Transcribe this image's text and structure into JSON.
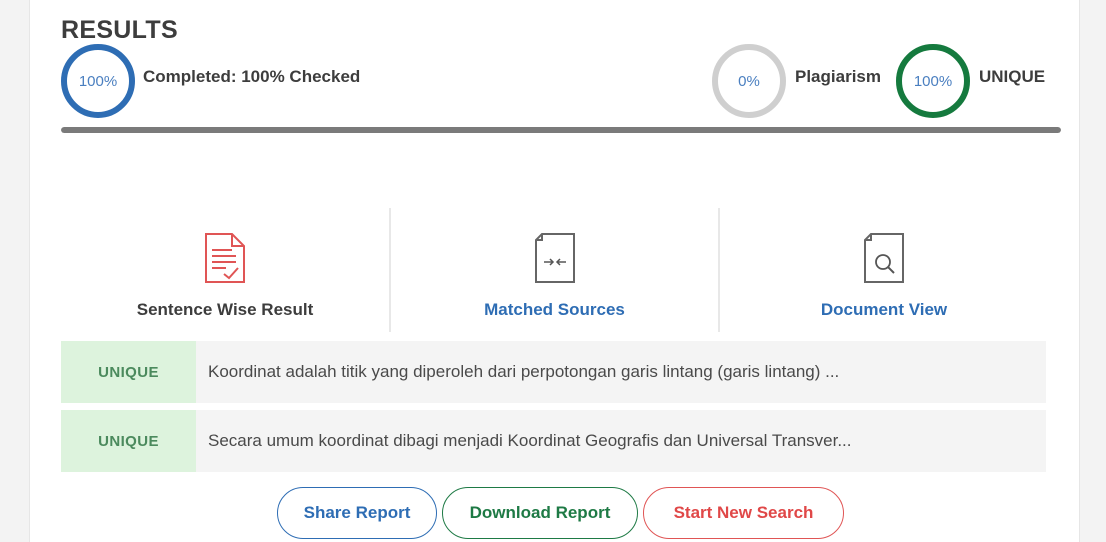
{
  "results": {
    "title": "RESULTS",
    "completed_percent": "100%",
    "completed_label": "Completed: 100% Checked",
    "plagiarism_percent": "0%",
    "plagiarism_label": "Plagiarism",
    "unique_percent": "100%",
    "unique_label": "UNIQUE",
    "progress_fraction": 1.0
  },
  "tabs": [
    {
      "label": "Sentence Wise Result",
      "icon": "document-check-icon",
      "color": "#e05555"
    },
    {
      "label": "Matched Sources",
      "icon": "document-compare-icon",
      "color": "#2e6db4"
    },
    {
      "label": "Document View",
      "icon": "document-search-icon",
      "color": "#2e6db4"
    }
  ],
  "sentences": [
    {
      "status": "UNIQUE",
      "text": "Koordinat adalah titik yang diperoleh dari perpotongan garis lintang (garis lintang) ..."
    },
    {
      "status": "UNIQUE",
      "text": "Secara umum koordinat dibagi menjadi Koordinat Geografis dan Universal Transver..."
    }
  ],
  "actions": {
    "share": "Share Report",
    "download": "Download Report",
    "new_search": "Start New Search"
  },
  "colors": {
    "blue": "#2e6db4",
    "green": "#157a3e",
    "grey": "#cfcfcf",
    "red": "#e05555",
    "unique_bg": "#ddf3dd"
  }
}
